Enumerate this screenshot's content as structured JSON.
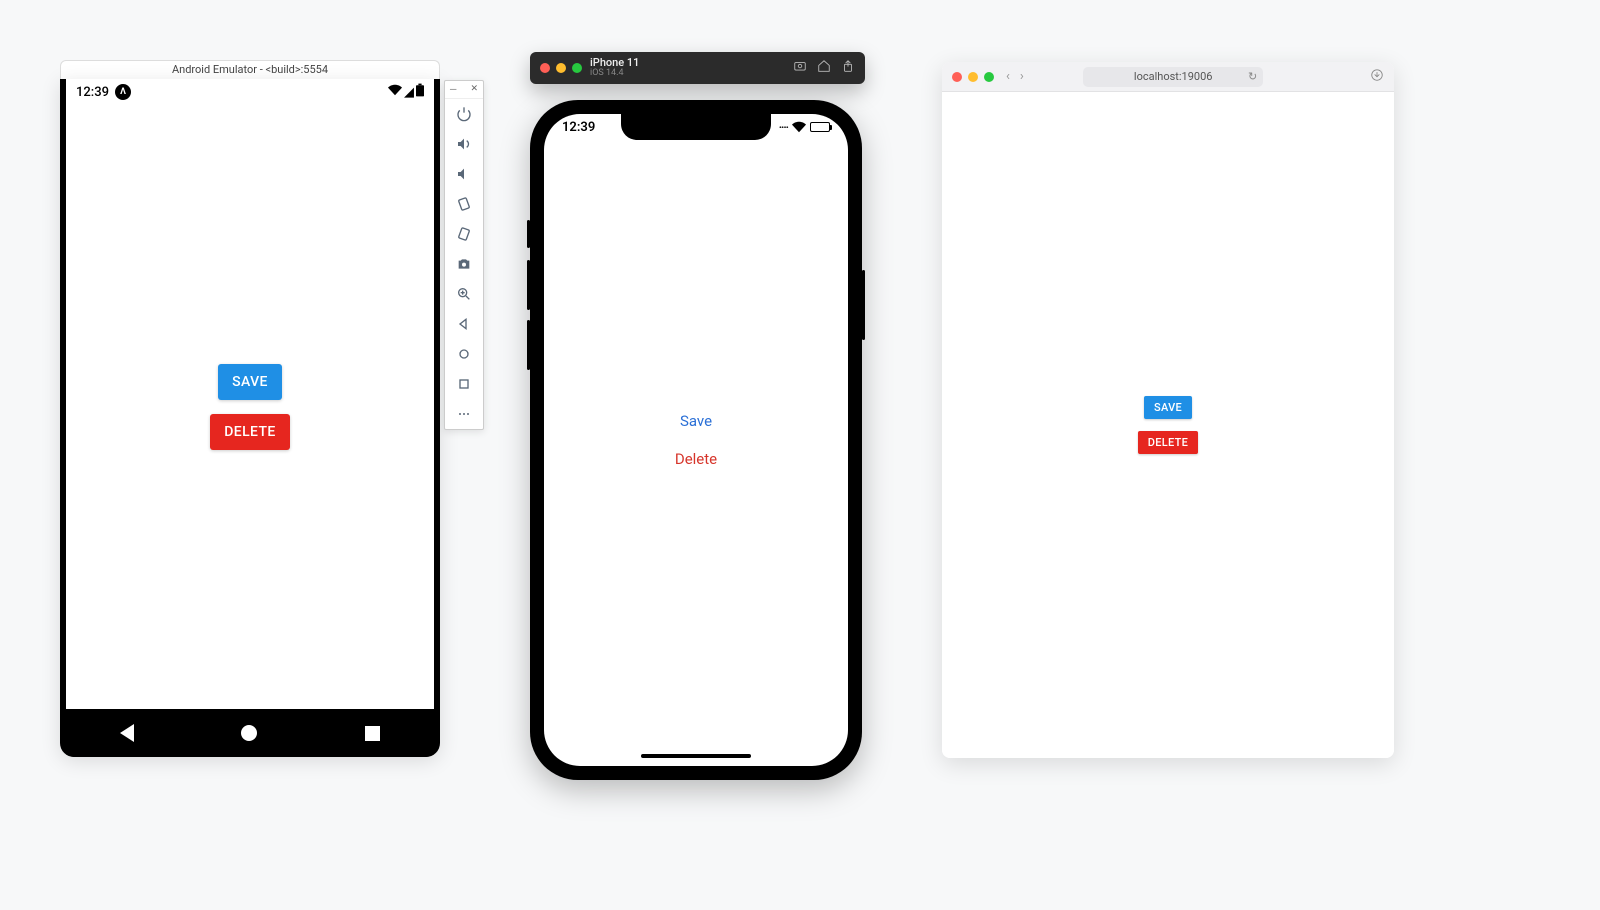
{
  "android": {
    "title": "Android Emulator - <build>:5554",
    "status_time": "12:39",
    "avatar_letter": "Λ",
    "buttons": {
      "save": {
        "label": "SAVE",
        "bg": "#1f8fe5"
      },
      "delete": {
        "label": "DELETE",
        "bg": "#e6261f"
      }
    },
    "sidebar_icons": [
      "power",
      "volume-up",
      "volume-down",
      "rotate-left",
      "rotate-right",
      "camera",
      "zoom",
      "back",
      "home",
      "recent",
      "more"
    ]
  },
  "ios": {
    "titlebar": {
      "device": "iPhone 11",
      "os": "iOS 14.4"
    },
    "status_time": "12:39",
    "buttons": {
      "save": {
        "label": "Save",
        "color": "#2a6fd6"
      },
      "delete": {
        "label": "Delete",
        "color": "#d6342a"
      }
    }
  },
  "web": {
    "url": "localhost:19006",
    "buttons": {
      "save": {
        "label": "SAVE",
        "bg": "#1f8fe5"
      },
      "delete": {
        "label": "DELETE",
        "bg": "#e6261f"
      }
    }
  },
  "colors": {
    "blue": "#1f8fe5",
    "red": "#e6261f",
    "ios_blue": "#2a6fd6",
    "ios_red": "#d6342a"
  }
}
